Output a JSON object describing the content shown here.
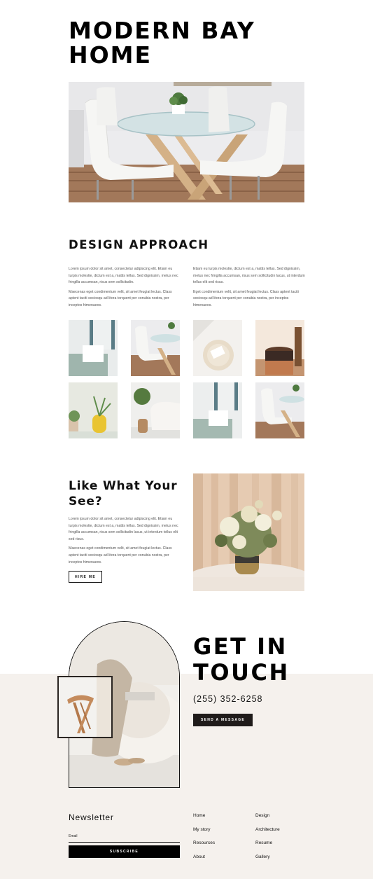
{
  "hero": {
    "title": "MODERN BAY HOME"
  },
  "design": {
    "heading": "DESIGN APPROACH",
    "col1": [
      "Lorem ipsum dolor sit amet, consectetur adipiscing elit. Etiam eu turpis molestie, dictum est a, mattis tellus. Sed dignissim, metus nec fringilla accumsan, risus sem sollicitudin.",
      "Maecenas eget condimentum velit, sit amet feugiat lectus. Class aptent taciti sociosqu ad litora torquent per conubia nostra, per inceptos himenaeos."
    ],
    "col2": [
      "Etiam eu turpis molestie, dictum est a, mattis tellus. Sed dignissim, metus nec fringilla accumsan, risus sem sollicitudin lacus, ut interdum tellus elit sed risus.",
      "Eget condimentum velit, sit amet feugiat lectus. Class aptent taciti sociosqu ad litora torquent per conubia nostra, per inceptos himenaeos."
    ]
  },
  "like": {
    "heading": "Like What Your See?",
    "paragraphs": [
      "Lorem ipsum dolor sit amet, consectetur adipiscing elit. Etiam eu turpis molestie, dictum est a, mattis tellus. Sed dignissim, metus nec fringilla accumsan, risus sem sollicitudin lacus, ut interdum tellus elit sed risus.",
      "Maecenas eget condimentum velit, sit amet feugiat lectus. Class aptent taciti sociosqu ad litora torquent per conubia nostra, per inceptos himenaeos."
    ],
    "button": "HIRE ME"
  },
  "contact": {
    "heading": "GET IN TOUCH",
    "phone": "(255) 352-6258",
    "button": "SEND A MESSAGE"
  },
  "footer": {
    "newsletter_title": "Newsletter",
    "email_label": "Email",
    "subscribe": "SUBSCRIBE",
    "links_col1": [
      "Home",
      "My story",
      "Resources",
      "About"
    ],
    "links_col2": [
      "Design",
      "Architecture",
      "Resume",
      "Gallery"
    ]
  },
  "colors": {
    "dark": "#1f1b1a",
    "footer_bg": "#f5f1ed"
  }
}
